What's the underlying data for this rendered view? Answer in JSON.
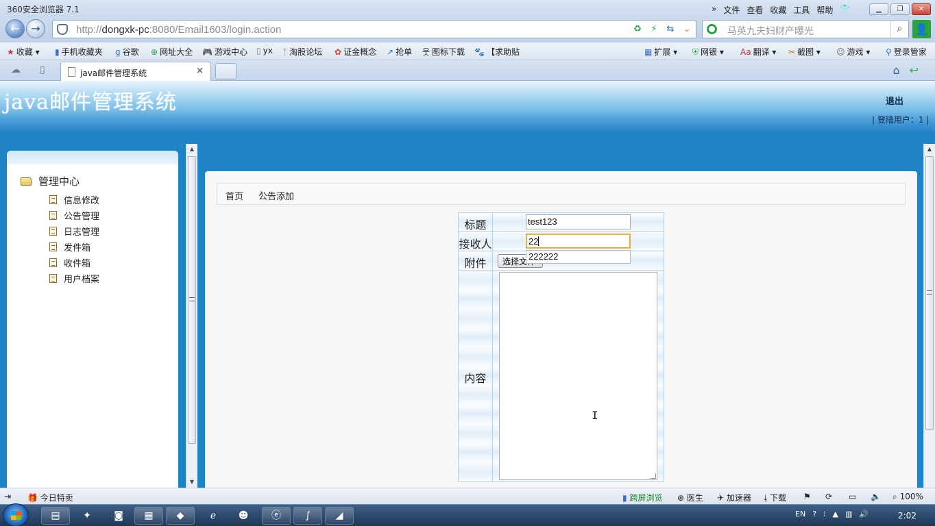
{
  "browser": {
    "app_title": "360安全浏览器 7.1",
    "menus": [
      "文件",
      "查看",
      "收藏",
      "工具",
      "帮助"
    ],
    "url_prefix": "http://",
    "url_host": "dongxk-pc",
    "url_rest": ":8080/Email1603/login.action",
    "search_placeholder": "马英九夫妇财产曝光",
    "favorites": [
      "收藏",
      "手机收藏夹",
      "谷歌",
      "网址大全",
      "游戏中心",
      "yx",
      "淘股论坛",
      "证金概念",
      "抢单",
      "图标下载",
      "【求助贴"
    ],
    "toolbar_right": [
      "扩展",
      "网银",
      "翻译",
      "截图",
      "游戏",
      "登录管家"
    ],
    "tab_title": "java邮件管理系统"
  },
  "header": {
    "site_title": "java邮件管理系统",
    "logout": "退出",
    "login_user": "| 登陆用户：1 |"
  },
  "sidebar": {
    "root": "管理中心",
    "items": [
      "信息修改",
      "公告管理",
      "日志管理",
      "发件箱",
      "收件箱",
      "用户档案"
    ]
  },
  "breadcrumb": {
    "home": "首页",
    "current": "公告添加"
  },
  "form": {
    "title_label": "标题",
    "title_value": "test123",
    "recipient_label": "接收人",
    "recipient_value": "22",
    "autocomplete_option": "222222",
    "attachment_label": "附件",
    "file_button": "选择文件",
    "content_label": "内容"
  },
  "statusbar": {
    "left_item": "今日特卖",
    "items": [
      "跨屏浏览",
      "医生",
      "加速器",
      "下载"
    ],
    "zoom": "100%"
  },
  "taskbar": {
    "lang": "EN",
    "clock": "2:02"
  }
}
